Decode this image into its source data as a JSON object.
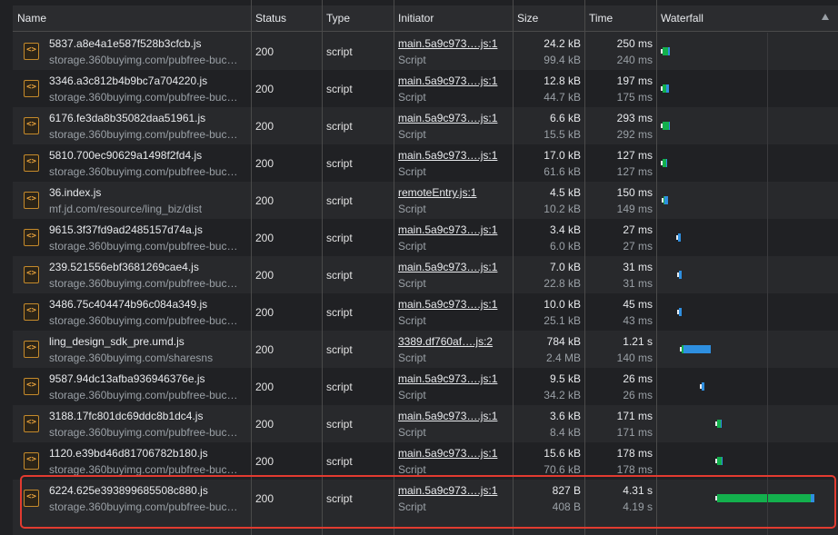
{
  "columns": {
    "name": "Name",
    "status": "Status",
    "type": "Type",
    "initiator": "Initiator",
    "size": "Size",
    "time": "Time",
    "waterfall": "Waterfall"
  },
  "rows": [
    {
      "file": "5837.a8e4a1e587f528b3cfcb.js",
      "domain": "storage.360buyimg.com/pubfree-buc…",
      "status": "200",
      "type": "script",
      "initiator": "main.5a9c973….js:1",
      "initiator_type": "Script",
      "size": "24.2 kB",
      "resource_size": "99.4 kB",
      "time": "250 ms",
      "latency": "240 ms"
    },
    {
      "file": "3346.a3c812b4b9bc7a704220.js",
      "domain": "storage.360buyimg.com/pubfree-buc…",
      "status": "200",
      "type": "script",
      "initiator": "main.5a9c973….js:1",
      "initiator_type": "Script",
      "size": "12.8 kB",
      "resource_size": "44.7 kB",
      "time": "197 ms",
      "latency": "175 ms"
    },
    {
      "file": "6176.fe3da8b35082daa51961.js",
      "domain": "storage.360buyimg.com/pubfree-buc…",
      "status": "200",
      "type": "script",
      "initiator": "main.5a9c973….js:1",
      "initiator_type": "Script",
      "size": "6.6 kB",
      "resource_size": "15.5 kB",
      "time": "293 ms",
      "latency": "292 ms"
    },
    {
      "file": "5810.700ec90629a1498f2fd4.js",
      "domain": "storage.360buyimg.com/pubfree-buc…",
      "status": "200",
      "type": "script",
      "initiator": "main.5a9c973….js:1",
      "initiator_type": "Script",
      "size": "17.0 kB",
      "resource_size": "61.6 kB",
      "time": "127 ms",
      "latency": "127 ms"
    },
    {
      "file": "36.index.js",
      "domain": "mf.jd.com/resource/ling_biz/dist",
      "status": "200",
      "type": "script",
      "initiator": "remoteEntry.js:1",
      "initiator_type": "Script",
      "size": "4.5 kB",
      "resource_size": "10.2 kB",
      "time": "150 ms",
      "latency": "149 ms"
    },
    {
      "file": "9615.3f37fd9ad2485157d74a.js",
      "domain": "storage.360buyimg.com/pubfree-buc…",
      "status": "200",
      "type": "script",
      "initiator": "main.5a9c973….js:1",
      "initiator_type": "Script",
      "size": "3.4 kB",
      "resource_size": "6.0 kB",
      "time": "27 ms",
      "latency": "27 ms"
    },
    {
      "file": "239.521556ebf3681269cae4.js",
      "domain": "storage.360buyimg.com/pubfree-buc…",
      "status": "200",
      "type": "script",
      "initiator": "main.5a9c973….js:1",
      "initiator_type": "Script",
      "size": "7.0 kB",
      "resource_size": "22.8 kB",
      "time": "31 ms",
      "latency": "31 ms"
    },
    {
      "file": "3486.75c404474b96c084a349.js",
      "domain": "storage.360buyimg.com/pubfree-buc…",
      "status": "200",
      "type": "script",
      "initiator": "main.5a9c973….js:1",
      "initiator_type": "Script",
      "size": "10.0 kB",
      "resource_size": "25.1 kB",
      "time": "45 ms",
      "latency": "43 ms"
    },
    {
      "file": "ling_design_sdk_pre.umd.js",
      "domain": "storage.360buyimg.com/sharesns",
      "status": "200",
      "type": "script",
      "initiator": "3389.df760af….js:2",
      "initiator_type": "Script",
      "size": "784 kB",
      "resource_size": "2.4 MB",
      "time": "1.21 s",
      "latency": "140 ms"
    },
    {
      "file": "9587.94dc13afba936946376e.js",
      "domain": "storage.360buyimg.com/pubfree-buc…",
      "status": "200",
      "type": "script",
      "initiator": "main.5a9c973….js:1",
      "initiator_type": "Script",
      "size": "9.5 kB",
      "resource_size": "34.2 kB",
      "time": "26 ms",
      "latency": "26 ms"
    },
    {
      "file": "3188.17fc801dc69ddc8b1dc4.js",
      "domain": "storage.360buyimg.com/pubfree-buc…",
      "status": "200",
      "type": "script",
      "initiator": "main.5a9c973….js:1",
      "initiator_type": "Script",
      "size": "3.6 kB",
      "resource_size": "8.4 kB",
      "time": "171 ms",
      "latency": "171 ms"
    },
    {
      "file": "1120.e39bd46d81706782b180.js",
      "domain": "storage.360buyimg.com/pubfree-buc…",
      "status": "200",
      "type": "script",
      "initiator": "main.5a9c973….js:1",
      "initiator_type": "Script",
      "size": "15.6 kB",
      "resource_size": "70.6 kB",
      "time": "178 ms",
      "latency": "178 ms"
    },
    {
      "file": "6224.625e393899685508c880.js",
      "domain": "storage.360buyimg.com/pubfree-buc…",
      "status": "200",
      "type": "script",
      "initiator": "main.5a9c973….js:1",
      "initiator_type": "Script",
      "size": "827 B",
      "resource_size": "408 B",
      "time": "4.31 s",
      "latency": "4.19 s"
    }
  ],
  "icons": {
    "file_icon": "script-file-icon",
    "file_icon_glyph": "<>",
    "sort": "sort-ascending-icon"
  },
  "colors": {
    "waiting": "#13b04d",
    "download": "#2e8fe0",
    "highlight": "#e23b30",
    "script_icon": "#f0a73d"
  }
}
